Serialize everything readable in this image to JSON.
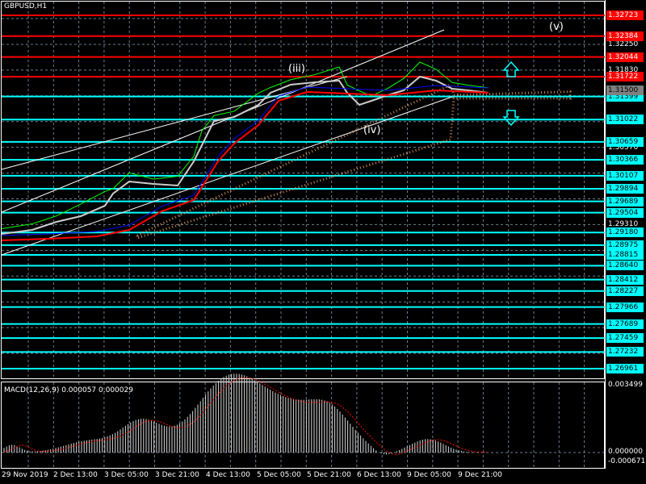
{
  "symbol_title": "GBPUSD,H1",
  "colors": {
    "resistance": "#ff0000",
    "support": "#00ffff",
    "current": "#808080",
    "bull_ma": "#ff0000",
    "fast_ma": "#0000ff",
    "price": "#00ff00",
    "cloud": "#f4a460"
  },
  "chart_data": {
    "type": "line",
    "title": "GBPUSD,H1",
    "ylim": [
      1.2667,
      1.3297
    ],
    "price_ticks": [
      "1.32250",
      "1.31830",
      "1.30570",
      "1.29310"
    ],
    "current_price": "1.31500",
    "resistance_levels": [
      "1.32723",
      "1.32384",
      "1.32044",
      "1.31722"
    ],
    "support_levels": [
      "1.31399",
      "1.31022",
      "1.30659",
      "1.30366",
      "1.30107",
      "1.29894",
      "1.29689",
      "1.29504",
      "1.29180",
      "1.28975",
      "1.28815",
      "1.28640",
      "1.28412",
      "1.28227",
      "1.27966",
      "1.27689",
      "1.27459",
      "1.27232",
      "1.26961"
    ],
    "wave_labels": [
      "(iii)",
      "(iv)",
      "(v)"
    ],
    "time_labels": [
      "29 Nov 2019",
      "2 Dec 13:00",
      "3 Dec 05:00",
      "3 Dec 21:00",
      "4 Dec 13:00",
      "5 Dec 05:00",
      "5 Dec 21:00",
      "6 Dec 13:00",
      "9 Dec 05:00",
      "9 Dec 21:00"
    ],
    "macd": {
      "label": "MACD(12,26,9) 0.000057 0.000029",
      "ylim": [
        -0.000671,
        0.003499
      ],
      "ticks": [
        "0.003499",
        "0.000000",
        "-0.000671"
      ]
    }
  }
}
